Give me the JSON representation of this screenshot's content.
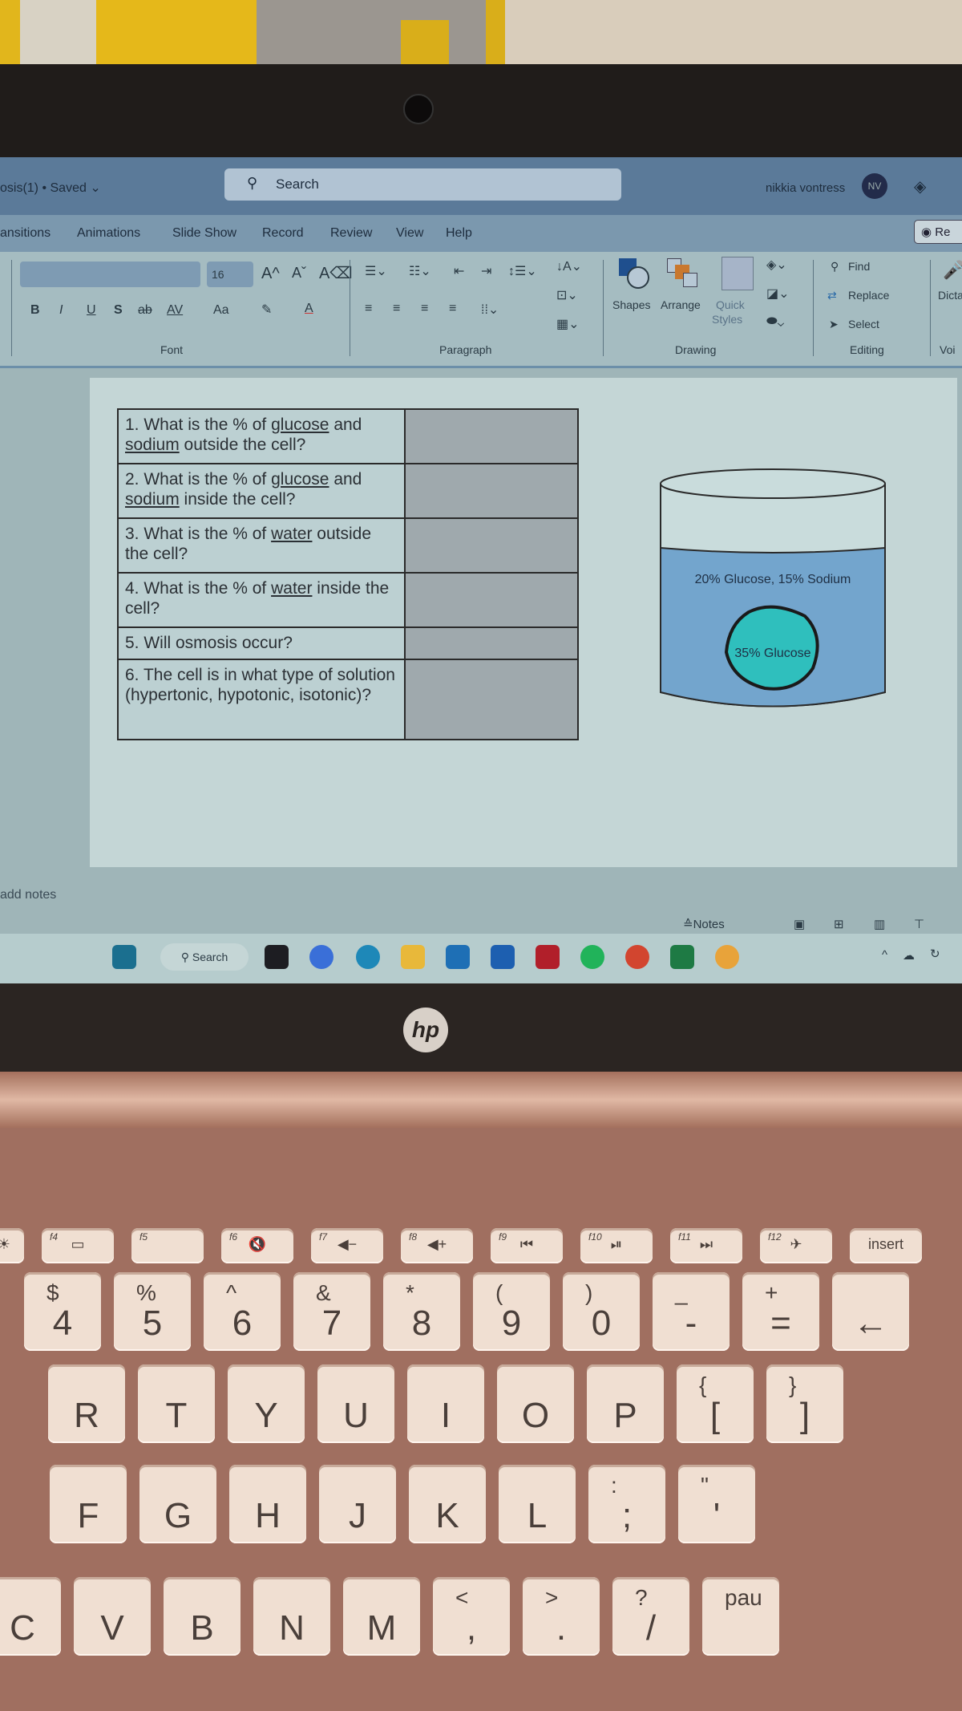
{
  "window": {
    "title": "osis(1) • Saved ⌄",
    "search_placeholder": "Search",
    "user_name": "nikkia vontress",
    "user_initials": "NV",
    "record_button": "Re"
  },
  "menu": [
    "ansitions",
    "Animations",
    "Slide Show",
    "Record",
    "Review",
    "View",
    "Help"
  ],
  "ribbon": {
    "font": {
      "name": "",
      "size": "16",
      "grow": "A^",
      "shrink": "Aˇ",
      "clear": "A⌫",
      "bold": "B",
      "italic": "I",
      "underline": "U",
      "shadow": "S",
      "strike": "ab",
      "spacing": "AV",
      "case": "Aa",
      "highlight": "✎",
      "color": "A",
      "label": "Font"
    },
    "paragraph": {
      "label": "Paragraph"
    },
    "drawing": {
      "shapes": "Shapes",
      "arrange": "Arrange",
      "quick_styles_1": "Quick",
      "quick_styles_2": "Styles",
      "label": "Drawing"
    },
    "editing": {
      "find": "Find",
      "replace": "Replace",
      "select": "Select",
      "label": "Editing"
    },
    "voice": {
      "dictate": "Dicta",
      "label": "Voi"
    }
  },
  "slide": {
    "questions": [
      {
        "num": "1.",
        "pre": " What is the % of ",
        "u1": "glucose",
        "mid": " and ",
        "u2": "sodium",
        "post": " outside the cell?"
      },
      {
        "num": "2.",
        "pre": " What is the % of ",
        "u1": "glucose",
        "mid": " and ",
        "u2": "sodium",
        "post": " inside the cell?"
      },
      {
        "num": "3.",
        "pre": " What is the % of ",
        "u1": "water",
        "mid": "",
        "u2": "",
        "post": " outside the cell?"
      },
      {
        "num": "4.",
        "pre": " What is the  % of ",
        "u1": "water",
        "mid": "",
        "u2": "",
        "post": " inside the cell?"
      },
      {
        "num": "5.",
        "pre": " Will osmosis occur?",
        "u1": "",
        "mid": "",
        "u2": "",
        "post": ""
      },
      {
        "num": "6.",
        "pre": "  The cell is in what type of solution (hypertonic, hypotonic, isotonic)?",
        "u1": "",
        "mid": "",
        "u2": "",
        "post": ""
      }
    ],
    "answers": [
      "",
      "",
      "",
      "",
      "",
      ""
    ],
    "beaker_label": "20% Glucose, 15% Sodium",
    "cell_label": "35% Glucose"
  },
  "notes": {
    "placeholder": "add notes",
    "notes_button": "Notes"
  },
  "taskbar": {
    "search": "Search"
  },
  "brand": {
    "logo": "hp"
  },
  "keyboard": {
    "fn_row": [
      {
        "fn": "",
        "glyph": "☀"
      },
      {
        "fn": "f4",
        "glyph": "▭"
      },
      {
        "fn": "f5",
        "glyph": ""
      },
      {
        "fn": "f6",
        "glyph": "🔇"
      },
      {
        "fn": "f7",
        "glyph": "◀−"
      },
      {
        "fn": "f8",
        "glyph": "◀+"
      },
      {
        "fn": "f9",
        "glyph": "⏮"
      },
      {
        "fn": "f10",
        "glyph": "⏯"
      },
      {
        "fn": "f11",
        "glyph": "⏭"
      },
      {
        "fn": "f12",
        "glyph": "✈"
      },
      {
        "fn": "",
        "glyph": "insert"
      }
    ],
    "num_row": [
      {
        "top": "$",
        "main": "4"
      },
      {
        "top": "%",
        "main": "5"
      },
      {
        "top": "^",
        "main": "6"
      },
      {
        "top": "&",
        "main": "7"
      },
      {
        "top": "*",
        "main": "8"
      },
      {
        "top": "(",
        "main": "9"
      },
      {
        "top": ")",
        "main": "0"
      },
      {
        "top": "_",
        "main": "-"
      },
      {
        "top": "+",
        "main": "="
      },
      {
        "top": "",
        "main": "←"
      }
    ],
    "row_q": [
      {
        "top": "",
        "main": "R"
      },
      {
        "top": "",
        "main": "T"
      },
      {
        "top": "",
        "main": "Y"
      },
      {
        "top": "",
        "main": "U"
      },
      {
        "top": "",
        "main": "I"
      },
      {
        "top": "",
        "main": "O"
      },
      {
        "top": "",
        "main": "P"
      },
      {
        "top": "{",
        "main": "["
      },
      {
        "top": "}",
        "main": "]"
      }
    ],
    "row_a": [
      {
        "top": "",
        "main": "F"
      },
      {
        "top": "",
        "main": "G"
      },
      {
        "top": "",
        "main": "H"
      },
      {
        "top": "",
        "main": "J"
      },
      {
        "top": "",
        "main": "K"
      },
      {
        "top": "",
        "main": "L"
      },
      {
        "top": ":",
        "main": ";"
      },
      {
        "top": "\"",
        "main": "'"
      }
    ],
    "row_z": [
      {
        "top": "",
        "main": "C"
      },
      {
        "top": "",
        "main": "V"
      },
      {
        "top": "",
        "main": "B"
      },
      {
        "top": "",
        "main": "N"
      },
      {
        "top": "",
        "main": "M"
      },
      {
        "top": "<",
        "main": ","
      },
      {
        "top": ">",
        "main": "."
      },
      {
        "top": "?",
        "main": "/"
      },
      {
        "top": "pau",
        "main": ""
      }
    ]
  }
}
